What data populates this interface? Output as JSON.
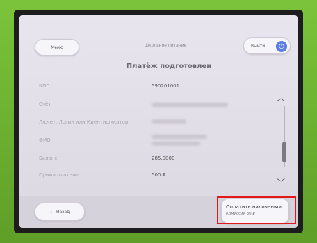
{
  "header": {
    "menu_label": "Меню",
    "service_name": "Школьное питание",
    "exit_label": "Выйти"
  },
  "screen_title": "Платёж подготовлен",
  "rows": [
    {
      "label": "КПП",
      "value": "590201001"
    },
    {
      "label": "Счёт",
      "value": ""
    },
    {
      "label": "Л/счет, Логин или Идентификатор",
      "value": ""
    },
    {
      "label": "ФИО",
      "value": ""
    },
    {
      "label": "Баланс",
      "value": "285.0000"
    },
    {
      "label": "Сумма платежа",
      "value": "500 ₽"
    }
  ],
  "footer": {
    "back_label": "Назад",
    "pay_label": "Оплатить наличными",
    "pay_commission": "Комиссия 30 ₽"
  },
  "colors": {
    "exit_icon_bg": "#5a7de0",
    "highlight_border": "#e11919"
  }
}
